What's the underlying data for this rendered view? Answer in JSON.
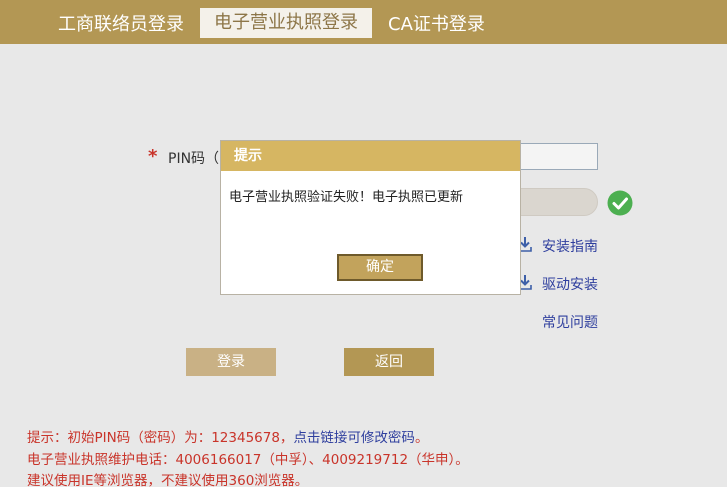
{
  "tabs": [
    {
      "label": "工商联络员登录",
      "active": false
    },
    {
      "label": "电子营业执照登录",
      "active": true
    },
    {
      "label": "CA证书登录",
      "active": false
    }
  ],
  "form": {
    "required_mark": "*",
    "pin_label": "PIN码（",
    "pin_value": ""
  },
  "links": {
    "install_guide": "安装指南",
    "driver_install": "驱动安装",
    "faq": "常见问题"
  },
  "buttons": {
    "login": "登录",
    "back": "返回"
  },
  "notices": {
    "line1_prefix": "提示：初始PIN码（密码）为：12345678，",
    "line1_link": "点击链接可修改密码",
    "line1_suffix": "。",
    "line2": "电子营业执照维护电话：4006166017（中孚）、4009219712（华申）。",
    "line3": "建议使用IE等浏览器，不建议使用360浏览器。"
  },
  "dialog": {
    "title": "提示",
    "message": "电子营业执照验证失败！电子执照已更新",
    "ok_label": "确定"
  },
  "colors": {
    "brand": "#b39754",
    "dialog_header": "#d6b662",
    "link": "#2f3f9e",
    "notice": "#c9342a",
    "success": "#4caf50"
  }
}
